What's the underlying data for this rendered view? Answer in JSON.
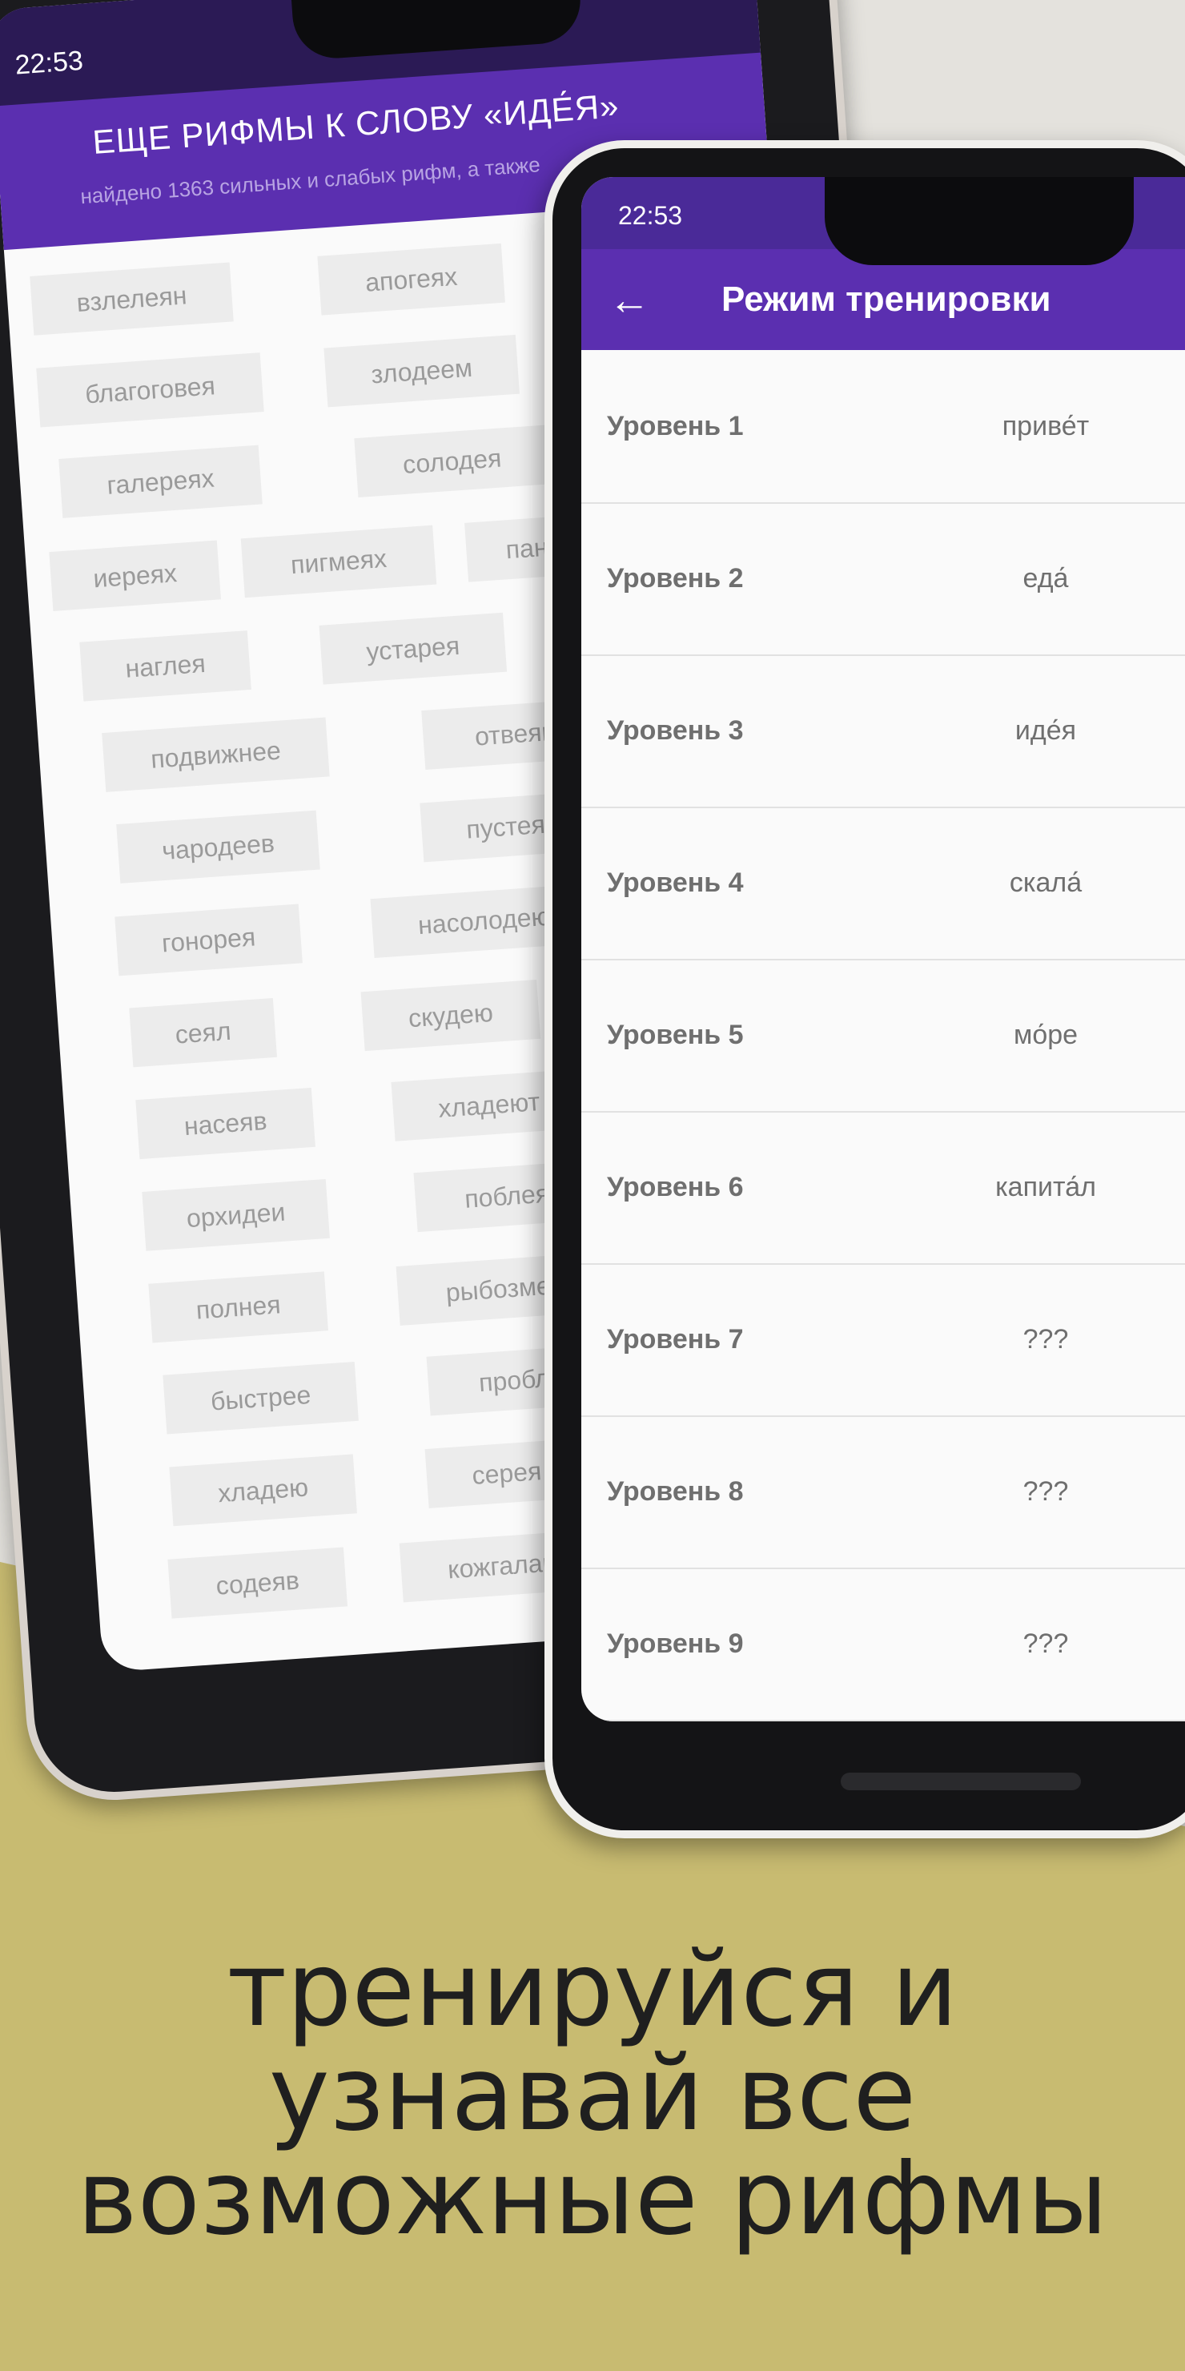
{
  "back_screen": {
    "status_time": "22:53",
    "title": "ЕЩЕ РИФМЫ К СЛОВУ «ИДЕ́Я»",
    "subtitle": "найдено 1363 сильных и слабых рифм, а также",
    "words": [
      [
        "взлелеян",
        "апогеях"
      ],
      [
        "благоговея",
        "злодеем"
      ],
      [
        "галереях",
        "солодея"
      ],
      [
        "иереях",
        "пигмеях",
        "панге"
      ],
      [
        "наглея",
        "устарея"
      ],
      [
        "подвижнее",
        "отвеян"
      ],
      [
        "чародеев",
        "пустея"
      ],
      [
        "гонорея",
        "насолодею"
      ],
      [
        "сеял",
        "скудею"
      ],
      [
        "насеяв",
        "хладеют"
      ],
      [
        "орхидеи",
        "поблеять"
      ],
      [
        "полнея",
        "рыбозмеям"
      ],
      [
        "быстрее",
        "проблея"
      ],
      [
        "хладею",
        "серея"
      ],
      [
        "содеяв",
        "кожгалантере"
      ]
    ]
  },
  "front_screen": {
    "status_time": "22:53",
    "back_icon": "arrow-left-icon",
    "title": "Режим тренировки",
    "levels": [
      {
        "name": "Уровень 1",
        "word": "приве́т"
      },
      {
        "name": "Уровень 2",
        "word": "еда́"
      },
      {
        "name": "Уровень 3",
        "word": "иде́я"
      },
      {
        "name": "Уровень 4",
        "word": "скала́"
      },
      {
        "name": "Уровень 5",
        "word": "мо́ре"
      },
      {
        "name": "Уровень 6",
        "word": "капита́л"
      },
      {
        "name": "Уровень 7",
        "word": "???"
      },
      {
        "name": "Уровень 8",
        "word": "???"
      },
      {
        "name": "Уровень 9",
        "word": "???"
      }
    ]
  },
  "caption": {
    "line1": "тренируйся и",
    "line2": "узнавай все",
    "line3": "возможные рифмы"
  },
  "colors": {
    "background_gold": "#c8bb71",
    "app_purple": "#5b2fb0",
    "status_purple": "#4a2a98"
  }
}
